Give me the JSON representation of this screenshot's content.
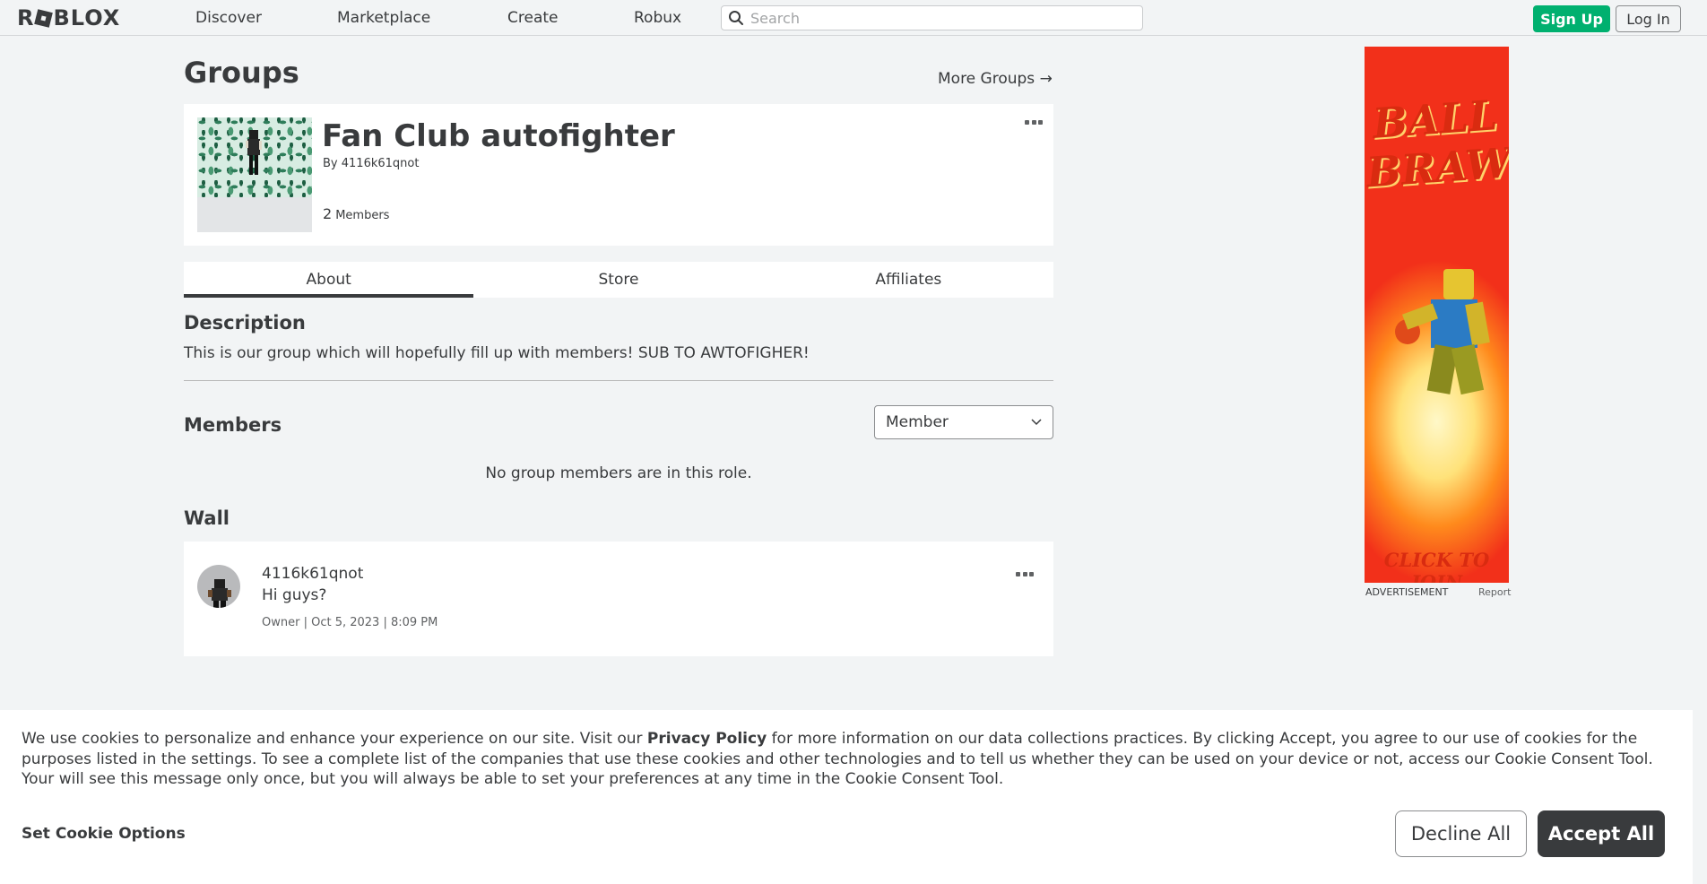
{
  "nav": {
    "logo_text": "ROBLOX",
    "links": [
      "Discover",
      "Marketplace",
      "Create",
      "Robux"
    ],
    "search_placeholder": "Search",
    "signup_label": "Sign Up",
    "login_label": "Log In"
  },
  "page": {
    "title": "Groups",
    "more_groups": "More Groups →"
  },
  "group": {
    "name": "Fan Club autofighter",
    "by_prefix": "By",
    "owner": "4116k61qnot",
    "member_count": "2",
    "member_label": "Members"
  },
  "tabs": [
    "About",
    "Store",
    "Affiliates"
  ],
  "about": {
    "description_heading": "Description",
    "description": "This is our group which will hopefully fill up with members! SUB TO AWTOFIGHER!",
    "members_heading": "Members",
    "role_selected": "Member",
    "empty_members": "No group members are in this role.",
    "wall_heading": "Wall"
  },
  "wall_post": {
    "author": "4116k61qnot",
    "body": "Hi guys?",
    "meta": "Owner | Oct 5, 2023 | 8:09 PM"
  },
  "ad": {
    "title_line1": "BALL",
    "title_line2": "BRAWL",
    "cta": "CLICK TO JOIN",
    "label": "ADVERTISEMENT",
    "report": "Report"
  },
  "cookie": {
    "text_before": "We use cookies to personalize and enhance your experience on our site. Visit our ",
    "privacy_link": "Privacy Policy",
    "text_after": " for more information on our data collections practices. By clicking Accept, you agree to our use of cookies for the purposes listed in the settings. To see a complete list of the companies that use these cookies and other technologies and to tell us whether they can be used on your device or not, access our Cookie Consent Tool. Your will see this message only once, but you will always be able to set your preferences at any time in the Cookie Consent Tool.",
    "options_label": "Set Cookie Options",
    "decline_label": "Decline All",
    "accept_label": "Accept All"
  },
  "colors": {
    "signup_green": "#00b06f",
    "text": "#393b3d",
    "background": "#f2f4f5"
  }
}
